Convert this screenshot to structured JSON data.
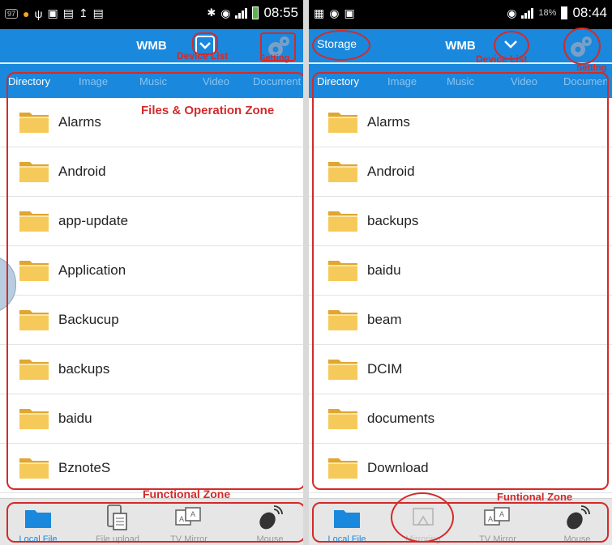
{
  "panels": [
    {
      "id": "left",
      "status_bar": {
        "time": "08:55",
        "battery_percent": "",
        "left_icons": [
          "notification-badge-97",
          "wechat-icon",
          "usb-icon",
          "screen-mirror-icon",
          "document-icon",
          "upload-icon",
          "image-icon"
        ],
        "notification_count": "97"
      },
      "header": {
        "title": "WMB",
        "storage_label": "",
        "device_list_annotation": "Device List",
        "setting_annotation": "Setting"
      },
      "tabs": [
        "Directory",
        "Image",
        "Music",
        "Video",
        "Document"
      ],
      "active_tab": 0,
      "files": [
        "Alarms",
        "Android",
        "app-update",
        "Application",
        "Backucup",
        "backups",
        "baidu",
        "BznoteS"
      ],
      "zone_annotation": "Files & Operation Zone",
      "functional_annotation": "Functional Zone",
      "bottom_tabs": [
        {
          "label": "Local File",
          "icon": "folder-icon"
        },
        {
          "label": "File upload",
          "icon": "file-upload-icon"
        },
        {
          "label": "TV Mirror",
          "icon": "tv-mirror-icon"
        },
        {
          "label": "Mouse",
          "icon": "mouse-icon"
        }
      ]
    },
    {
      "id": "right",
      "status_bar": {
        "time": "08:44",
        "battery_percent": "18%",
        "left_icons": [
          "app-icon",
          "app-icon-2",
          "image-icon"
        ]
      },
      "header": {
        "title": "WMB",
        "storage_label": "Storage",
        "device_list_annotation": "Device List",
        "setting_annotation": "Setting"
      },
      "tabs": [
        "Directory",
        "Image",
        "Music",
        "Video",
        "Documen"
      ],
      "active_tab": 0,
      "files": [
        "Alarms",
        "Android",
        "backups",
        "baidu",
        "beam",
        "DCIM",
        "documents",
        "Download"
      ],
      "functional_annotation": "Funtional Zone",
      "bottom_tabs": [
        {
          "label": "Local File",
          "icon": "folder-icon"
        },
        {
          "label": "Mirroring",
          "icon": "mirroring-icon"
        },
        {
          "label": "TV Mirror",
          "icon": "tv-mirror-icon"
        },
        {
          "label": "Mouse",
          "icon": "mouse-icon"
        }
      ]
    }
  ],
  "colors": {
    "header_blue": "#1a88dc",
    "annotation_red": "#d42a2a",
    "inactive_tab": "#8bc3ef",
    "folder_yellow": "#f4c04a"
  }
}
